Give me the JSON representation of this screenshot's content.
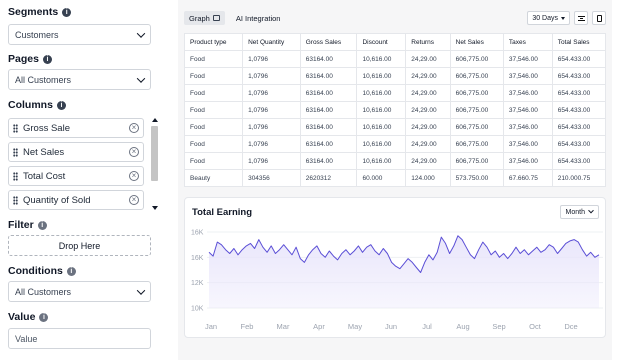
{
  "left": {
    "segments": {
      "title": "Segments",
      "value": "Customers"
    },
    "pages": {
      "title": "Pages",
      "value": "All Customers"
    },
    "columns": {
      "title": "Columns",
      "items": [
        "Gross Sale",
        "Net Sales",
        "Total Cost",
        "Quantity of Sold"
      ]
    },
    "filter": {
      "title": "Filter",
      "drop_label": "Drop Here"
    },
    "conditions": {
      "title": "Conditions",
      "value": "All Customers"
    },
    "value": {
      "title": "Value",
      "placeholder": "Value"
    }
  },
  "tabs": {
    "graph": "Graph",
    "ai": "AI Integration"
  },
  "toolbar": {
    "range": "30 Days"
  },
  "table": {
    "headers": [
      "Product type",
      "Net Quantity",
      "Gross Sales",
      "Discount",
      "Returns",
      "Net Sales",
      "Taxes",
      "Total Sales"
    ],
    "rows": [
      [
        "Food",
        "1,0796",
        "63164.00",
        "10,616.00",
        "24,29.00",
        "606,775.00",
        "37,546.00",
        "654.433.00"
      ],
      [
        "Food",
        "1,0796",
        "63164.00",
        "10,616.00",
        "24,29.00",
        "606,775.00",
        "37,546.00",
        "654.433.00"
      ],
      [
        "Food",
        "1,0796",
        "63164.00",
        "10,616.00",
        "24,29.00",
        "606,775.00",
        "37,546.00",
        "654.433.00"
      ],
      [
        "Food",
        "1,0796",
        "63164.00",
        "10,616.00",
        "24,29.00",
        "606,775.00",
        "37,546.00",
        "654.433.00"
      ],
      [
        "Food",
        "1,0796",
        "63164.00",
        "10,616.00",
        "24,29.00",
        "606,775.00",
        "37,546.00",
        "654.433.00"
      ],
      [
        "Food",
        "1,0796",
        "63164.00",
        "10,616.00",
        "24,29.00",
        "606,775.00",
        "37,546.00",
        "654.433.00"
      ],
      [
        "Food",
        "1,0796",
        "63164.00",
        "10,616.00",
        "24,29.00",
        "606,775.00",
        "37,546.00",
        "654.433.00"
      ],
      [
        "Beauty",
        "304356",
        "2620312",
        "60.000",
        "124.000",
        "573.750.00",
        "67.660.75",
        "210.000.75"
      ]
    ]
  },
  "chart_data": {
    "type": "area",
    "title": "Total Earning",
    "period_label": "Month",
    "categories": [
      "Jan",
      "Feb",
      "Mar",
      "Apr",
      "May",
      "Jun",
      "Jul",
      "Aug",
      "Sep",
      "Oct",
      "Dce"
    ],
    "yticks": [
      "16K",
      "16K",
      "12K",
      "10K"
    ],
    "ylim": [
      10,
      16
    ],
    "grid": true,
    "line_color": "#5b4fd6",
    "fill_color": "#e9e6fb",
    "values": [
      14.4,
      14.1,
      15.2,
      15.0,
      14.6,
      14.3,
      14.7,
      14.2,
      14.6,
      14.9,
      15.1,
      14.7,
      15.4,
      14.8,
      14.4,
      14.9,
      14.3,
      14.6,
      15.0,
      14.6,
      14.2,
      14.8,
      13.9,
      13.6,
      14.2,
      14.6,
      14.9,
      14.3,
      14.0,
      14.5,
      14.1,
      13.8,
      14.3,
      14.6,
      14.2,
      14.5,
      14.9,
      14.4,
      14.8,
      15.0,
      14.5,
      14.2,
      14.7,
      14.3,
      13.6,
      13.3,
      13.1,
      13.5,
      13.9,
      13.6,
      13.2,
      12.8,
      13.6,
      14.2,
      13.8,
      14.4,
      15.6,
      15.1,
      14.3,
      14.9,
      15.7,
      15.4,
      14.8,
      14.2,
      13.9,
      14.6,
      15.2,
      14.8,
      14.2,
      14.5,
      14.0,
      14.3,
      13.9,
      14.3,
      14.8,
      14.3,
      14.6,
      14.2,
      14.5,
      14.8,
      14.4,
      14.6,
      15.0,
      14.8,
      14.3,
      14.7,
      15.1,
      15.3,
      15.4,
      15.2,
      14.6,
      14.1,
      14.4,
      14.0,
      14.2
    ]
  }
}
